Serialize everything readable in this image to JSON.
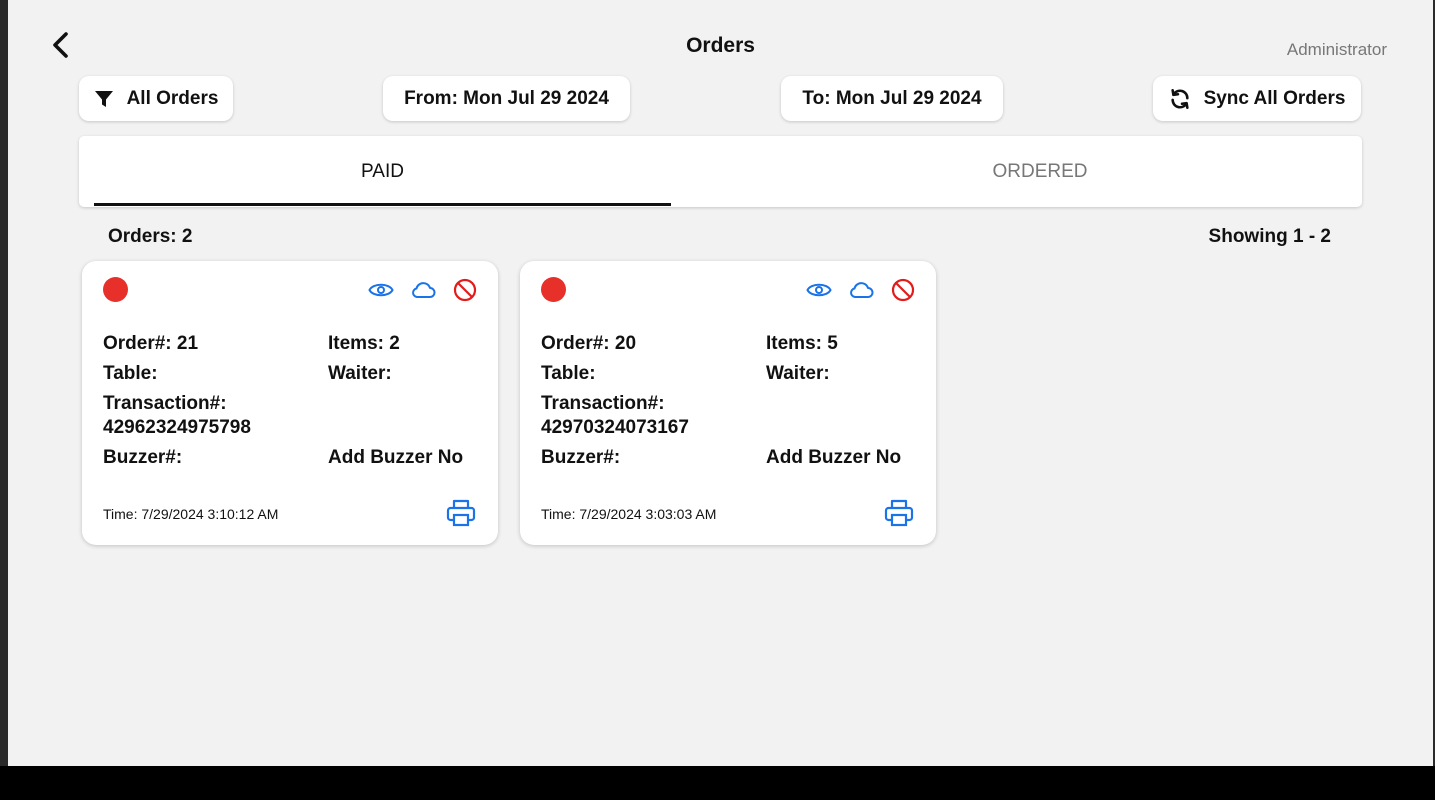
{
  "header": {
    "title": "Orders",
    "user": "Administrator"
  },
  "filters": {
    "all_orders": "All Orders",
    "from": "From: Mon Jul 29 2024",
    "to": "To: Mon Jul 29 2024",
    "sync": "Sync All Orders"
  },
  "tabs": [
    {
      "label": "PAID",
      "active": true
    },
    {
      "label": "ORDERED",
      "active": false
    }
  ],
  "summary": {
    "orders_count": "Orders: 2",
    "showing": "Showing 1 - 2"
  },
  "colors": {
    "status_red": "#e8302a",
    "icon_blue": "#1a73e8",
    "cancel_red": "#e21b1b"
  },
  "cards": [
    {
      "order": "Order#: 21",
      "items": "Items: 2",
      "table": "Table:",
      "waiter": "Waiter:",
      "transaction_label": "Transaction#:",
      "transaction": "42962324975798",
      "buzzer": "Buzzer#:",
      "add_buzzer": "Add Buzzer No",
      "time": "Time: 7/29/2024 3:10:12 AM"
    },
    {
      "order": "Order#: 20",
      "items": "Items: 5",
      "table": "Table:",
      "waiter": "Waiter:",
      "transaction_label": "Transaction#:",
      "transaction": "42970324073167",
      "buzzer": "Buzzer#:",
      "add_buzzer": "Add Buzzer No",
      "time": "Time: 7/29/2024 3:03:03 AM"
    }
  ],
  "icons": [
    "back-arrow-icon",
    "filter-icon",
    "sync-icon",
    "eye-icon",
    "cloud-icon",
    "cancel-icon",
    "printer-icon"
  ]
}
